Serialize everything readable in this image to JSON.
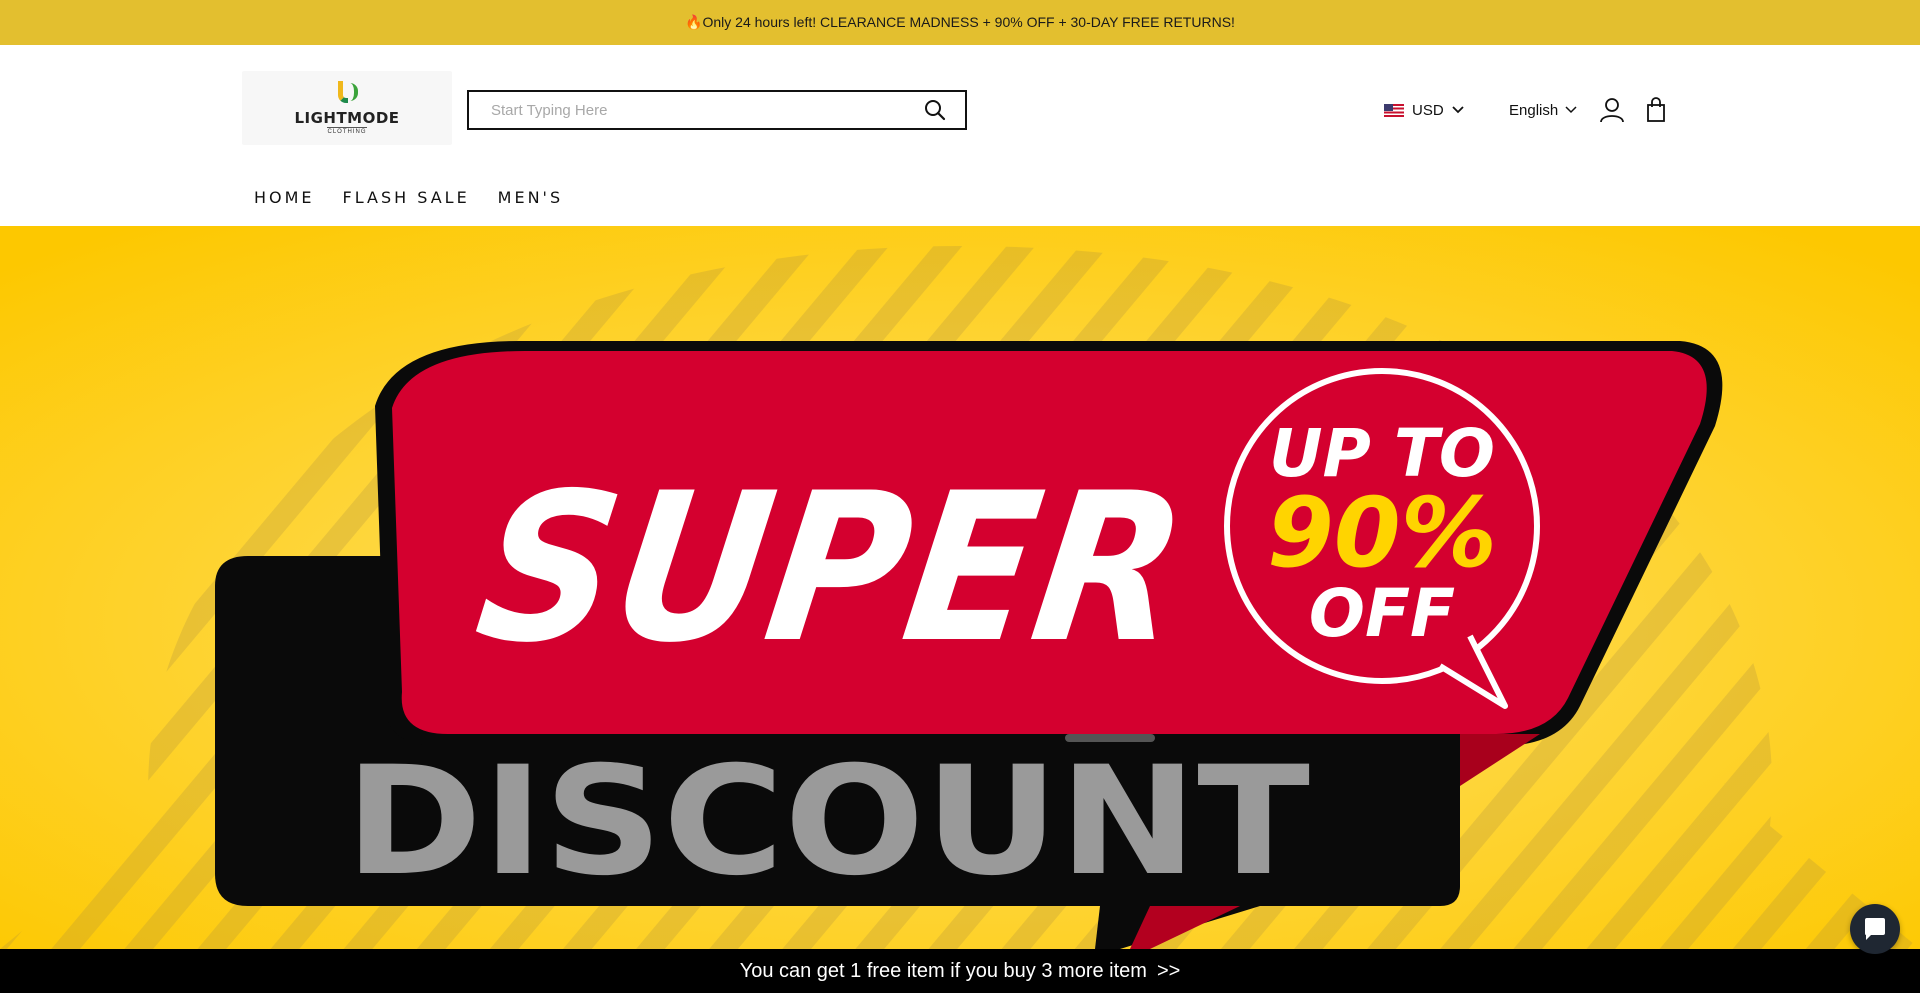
{
  "announcement": {
    "text": "🔥Only 24 hours left! CLEARANCE MADNESS + 90% OFF + 30-DAY FREE RETURNS!"
  },
  "header": {
    "logo": {
      "name": "LIGHTMODE",
      "tagline": "CLOTHING",
      "icon": "lightmode-logo"
    },
    "search": {
      "placeholder": "Start Typing Here",
      "value": "",
      "icon": "search-icon"
    },
    "currency": {
      "code": "USD",
      "flag": "us-flag-icon"
    },
    "language": {
      "label": "English"
    },
    "icons": {
      "account": "user-icon",
      "cart": "shopping-bag-icon"
    }
  },
  "nav": {
    "items": [
      {
        "label": "HOME"
      },
      {
        "label": "FLASH SALE"
      },
      {
        "label": "MEN'S"
      }
    ]
  },
  "hero": {
    "line1": "SUPER",
    "line2": "DISCOUNT",
    "badge": {
      "top": "UP TO",
      "value": "90%",
      "bottom": "OFF"
    },
    "colors": {
      "background": "#fdc800",
      "ribbon": "#d4002f",
      "plate": "#0a0a0a",
      "badge_value": "#ffd400"
    }
  },
  "promo_bar": {
    "text": "You can get 1 free item if you buy 3 more item",
    "arrow": ">>"
  },
  "chat": {
    "icon": "chat-bubble-icon"
  }
}
